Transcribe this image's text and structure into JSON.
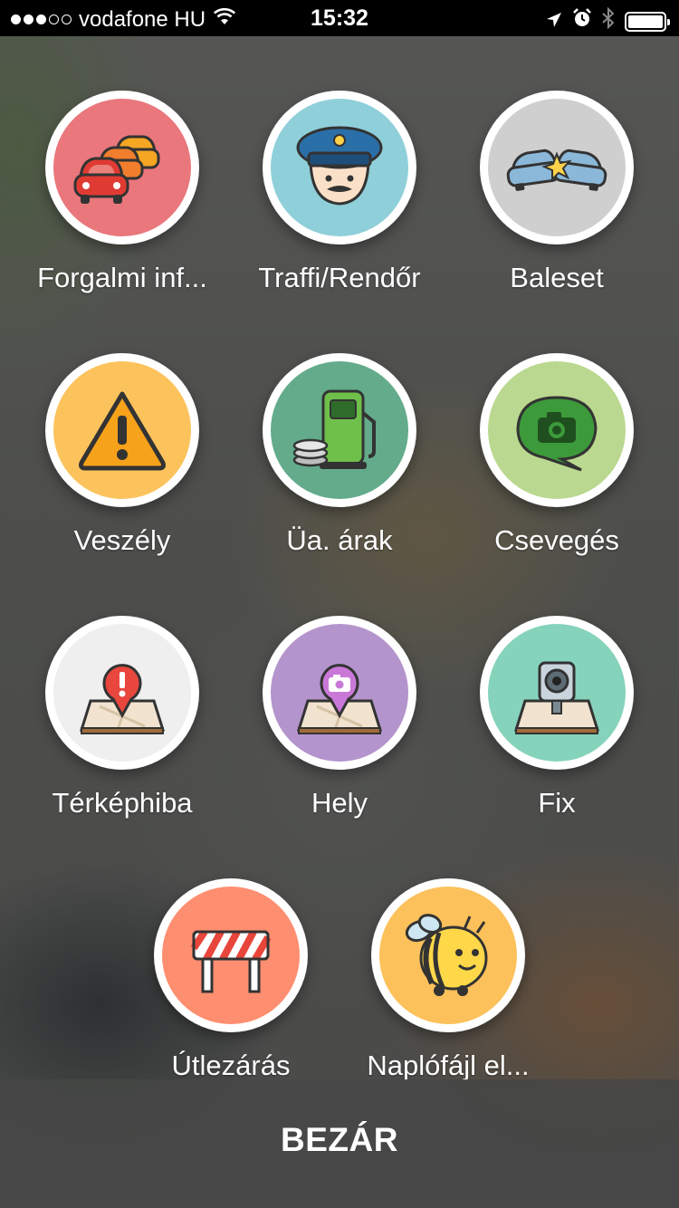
{
  "status_bar": {
    "carrier": "vodafone HU",
    "time": "15:32",
    "signal_icon": "signal-dots-icon",
    "wifi_icon": "wifi-icon",
    "location_icon": "location-arrow-icon",
    "alarm_icon": "alarm-clock-icon",
    "bluetooth_icon": "bluetooth-icon",
    "battery_icon": "battery-icon"
  },
  "items": [
    {
      "label": "Forgalmi inf...",
      "icon": "traffic-jam-icon",
      "color": "#e9777c"
    },
    {
      "label": "Traffi/Rendőr",
      "icon": "police-icon",
      "color": "#8fcfd9"
    },
    {
      "label": "Baleset",
      "icon": "crash-icon",
      "color": "#cfcfcf"
    },
    {
      "label": "Veszély",
      "icon": "hazard-warning-icon",
      "color": "#fcc35c"
    },
    {
      "label": "Üa. árak",
      "icon": "gas-price-icon",
      "color": "#63ab8a"
    },
    {
      "label": "Csevegés",
      "icon": "chat-camera-icon",
      "color": "#bad88f"
    },
    {
      "label": "Térképhiba",
      "icon": "map-error-icon",
      "color": "#efefef"
    },
    {
      "label": "Hely",
      "icon": "place-camera-icon",
      "color": "#b494cc"
    },
    {
      "label": "Fix",
      "icon": "speed-camera-icon",
      "color": "#86d3bb"
    },
    {
      "label": "Útlezárás",
      "icon": "road-closure-icon",
      "color": "#fe8e70"
    },
    {
      "label": "Naplófájl el...",
      "icon": "bee-log-icon",
      "color": "#fcc15b"
    }
  ],
  "close": {
    "label": "BEZÁR"
  }
}
